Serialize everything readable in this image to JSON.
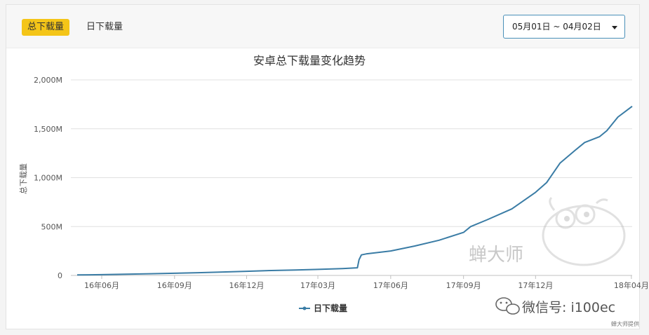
{
  "tabs": [
    {
      "label": "总下载量",
      "active": true
    },
    {
      "label": "日下载量",
      "active": false
    }
  ],
  "date_range": "05月01日 ~ 04月02日",
  "watermark": "蝉大师",
  "wechat_label": "微信号: i100ec",
  "credit": "蝉大师提供",
  "colors": {
    "accent_tab": "#f4c518",
    "line": "#3a7ca5",
    "select_border": "#4a90b8"
  },
  "chart_data": {
    "type": "line",
    "title": "安卓总下载量变化趋势",
    "xlabel": "",
    "ylabel": "总下载量",
    "ylim": [
      0,
      2000
    ],
    "y_ticks": [
      "0",
      "500M",
      "1,000M",
      "1,500M",
      "2,000M"
    ],
    "x_ticks": [
      "16年06月",
      "16年09月",
      "16年12月",
      "17年03月",
      "17年06月",
      "17年09月",
      "17年12月",
      "18年04月"
    ],
    "grid": true,
    "legend": "bottom",
    "series": [
      {
        "name": "日下载量",
        "x": [
          "2016-05-01",
          "2016-06-01",
          "2016-07-01",
          "2016-08-01",
          "2016-09-01",
          "2016-10-01",
          "2016-11-01",
          "2016-12-01",
          "2017-01-01",
          "2017-02-01",
          "2017-03-01",
          "2017-04-01",
          "2017-04-20",
          "2017-04-22",
          "2017-04-25",
          "2017-05-01",
          "2017-06-01",
          "2017-07-01",
          "2017-08-01",
          "2017-09-01",
          "2017-09-10",
          "2017-10-01",
          "2017-11-01",
          "2017-12-01",
          "2017-12-15",
          "2018-01-01",
          "2018-01-20",
          "2018-02-01",
          "2018-02-20",
          "2018-03-01",
          "2018-03-15",
          "2018-04-02"
        ],
        "values": [
          5,
          8,
          12,
          17,
          22,
          28,
          35,
          42,
          50,
          56,
          62,
          70,
          78,
          160,
          210,
          220,
          250,
          300,
          360,
          440,
          500,
          570,
          680,
          850,
          950,
          1150,
          1280,
          1360,
          1420,
          1480,
          1620,
          1730
        ]
      }
    ]
  }
}
